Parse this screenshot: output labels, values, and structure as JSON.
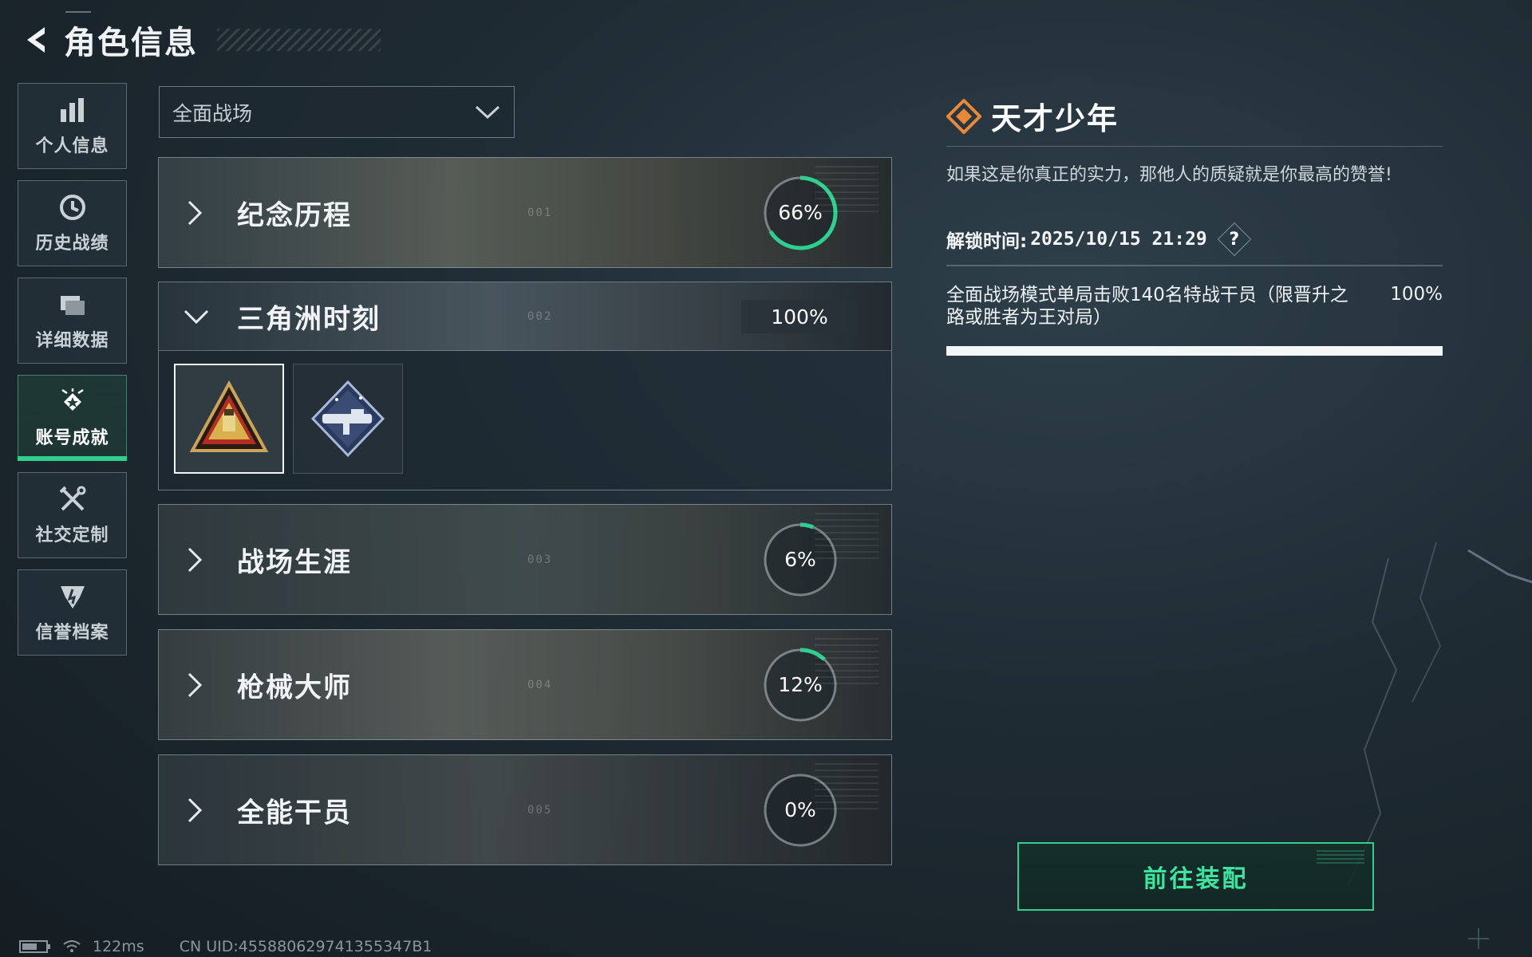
{
  "header": {
    "title": "角色信息"
  },
  "sidebar": {
    "items": [
      {
        "label": "个人信息",
        "icon": "bar-chart-icon",
        "active": false
      },
      {
        "label": "历史战绩",
        "icon": "clock-icon",
        "active": false
      },
      {
        "label": "详细数据",
        "icon": "folder-icon",
        "active": false
      },
      {
        "label": "账号成就",
        "icon": "medal-icon",
        "active": true
      },
      {
        "label": "社交定制",
        "icon": "tools-icon",
        "active": false
      },
      {
        "label": "信誉档案",
        "icon": "shield-icon",
        "active": false
      }
    ]
  },
  "filter": {
    "selected": "全面战场"
  },
  "categories": [
    {
      "label": "纪念历程",
      "number": "001",
      "progress": "66%",
      "progress_value": 0.66,
      "expanded": false
    },
    {
      "label": "三角洲时刻",
      "number": "002",
      "progress": "100%",
      "progress_value": 1.0,
      "expanded": true
    },
    {
      "label": "战场生涯",
      "number": "003",
      "progress": "6%",
      "progress_value": 0.06,
      "expanded": false
    },
    {
      "label": "枪械大师",
      "number": "004",
      "progress": "12%",
      "progress_value": 0.12,
      "expanded": false
    },
    {
      "label": "全能干员",
      "number": "005",
      "progress": "0%",
      "progress_value": 0.0,
      "expanded": false
    }
  ],
  "badges": [
    {
      "icon": "soldier-triangle-badge-icon",
      "selected": true
    },
    {
      "icon": "rocket-launcher-badge-icon",
      "selected": false
    }
  ],
  "detail": {
    "title": "天才少年",
    "description": "如果这是你真正的实力，那他人的质疑就是你最高的赞誉!",
    "unlock_label": "解锁时间:",
    "unlock_time": "2025/10/15 21:29",
    "help": "?",
    "requirement": "全面战场模式单局击败140名特战干员（限晋升之路或胜者为王对局）",
    "requirement_progress": "100%",
    "requirement_value": 1.0
  },
  "equip_button": {
    "label": "前往装配"
  },
  "status_bar": {
    "ping": "122ms",
    "uid": "CN UID:455880629741355347B1"
  },
  "colors": {
    "accent": "#2ecf8f",
    "title_icon": "#e8893a"
  }
}
